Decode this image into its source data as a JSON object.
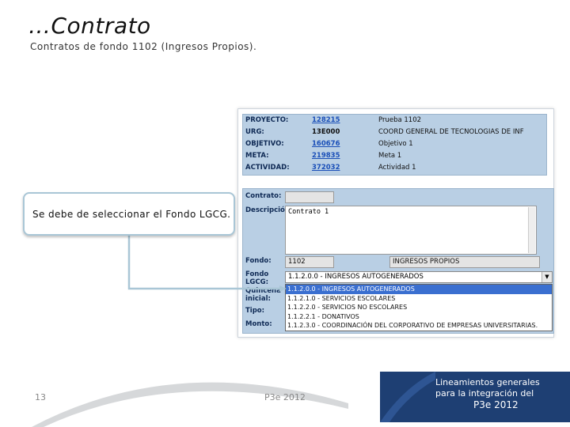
{
  "header": {
    "title": "…Contrato",
    "subtitle": "Contratos de fondo 1102 (Ingresos Propios)."
  },
  "form": {
    "info_rows": [
      {
        "label": "PROYECTO:",
        "code": "128215",
        "desc": "Prueba 1102",
        "link": true
      },
      {
        "label": "URG:",
        "code": "13E000",
        "desc": "COORD GENERAL DE TECNOLOGIAS DE INF",
        "link": false
      },
      {
        "label": "OBJETIVO:",
        "code": "160676",
        "desc": "Objetivo 1",
        "link": true
      },
      {
        "label": "META:",
        "code": "219835",
        "desc": "Meta 1",
        "link": true
      },
      {
        "label": "ACTIVIDAD:",
        "code": "372032",
        "desc": "Actividad 1",
        "link": true
      }
    ],
    "contrato_label": "Contrato:",
    "descripcion_label": "Descripción:",
    "descripcion_value": "Contrato 1",
    "fondo_label": "Fondo:",
    "fondo_code": "1102",
    "fondo_desc": "INGRESOS PROPIOS",
    "fondo_lgcg_label_1": "Fondo",
    "fondo_lgcg_label_2": "LGCG:",
    "quincena_label_1": "Quincena",
    "quincena_label_2": "inicial:",
    "tipo_label": "Tipo:",
    "monto_label": "Monto:",
    "fondo_lgcg_selected": "1.1.2.0.0 - INGRESOS AUTOGENERADOS",
    "fondo_lgcg_options": [
      "1.1.2.0.0 - INGRESOS AUTOGENERADOS",
      "1.1.2.1.0 - SERVICIOS ESCOLARES",
      "1.1.2.2.0 - SERVICIOS NO ESCOLARES",
      "1.1.2.2.1 - DONATIVOS",
      "1.1.2.3.0 - COORDINACIÓN DEL CORPORATIVO DE EMPRESAS UNIVERSITARIAS."
    ],
    "selected_index": 0
  },
  "callout": {
    "text": "Se debe de seleccionar el Fondo LGCG."
  },
  "footer": {
    "page_number": "13",
    "center_text": "P3e 2012",
    "banner_line1": "Lineamientos generales",
    "banner_line2": "para la integración del",
    "banner_line3": "P3e 2012"
  },
  "colors": {
    "panel_blue": "#b9cfe4",
    "selection_blue": "#3a6fd0",
    "link_blue": "#1a4fb8",
    "banner_navy": "#1e3f73"
  }
}
